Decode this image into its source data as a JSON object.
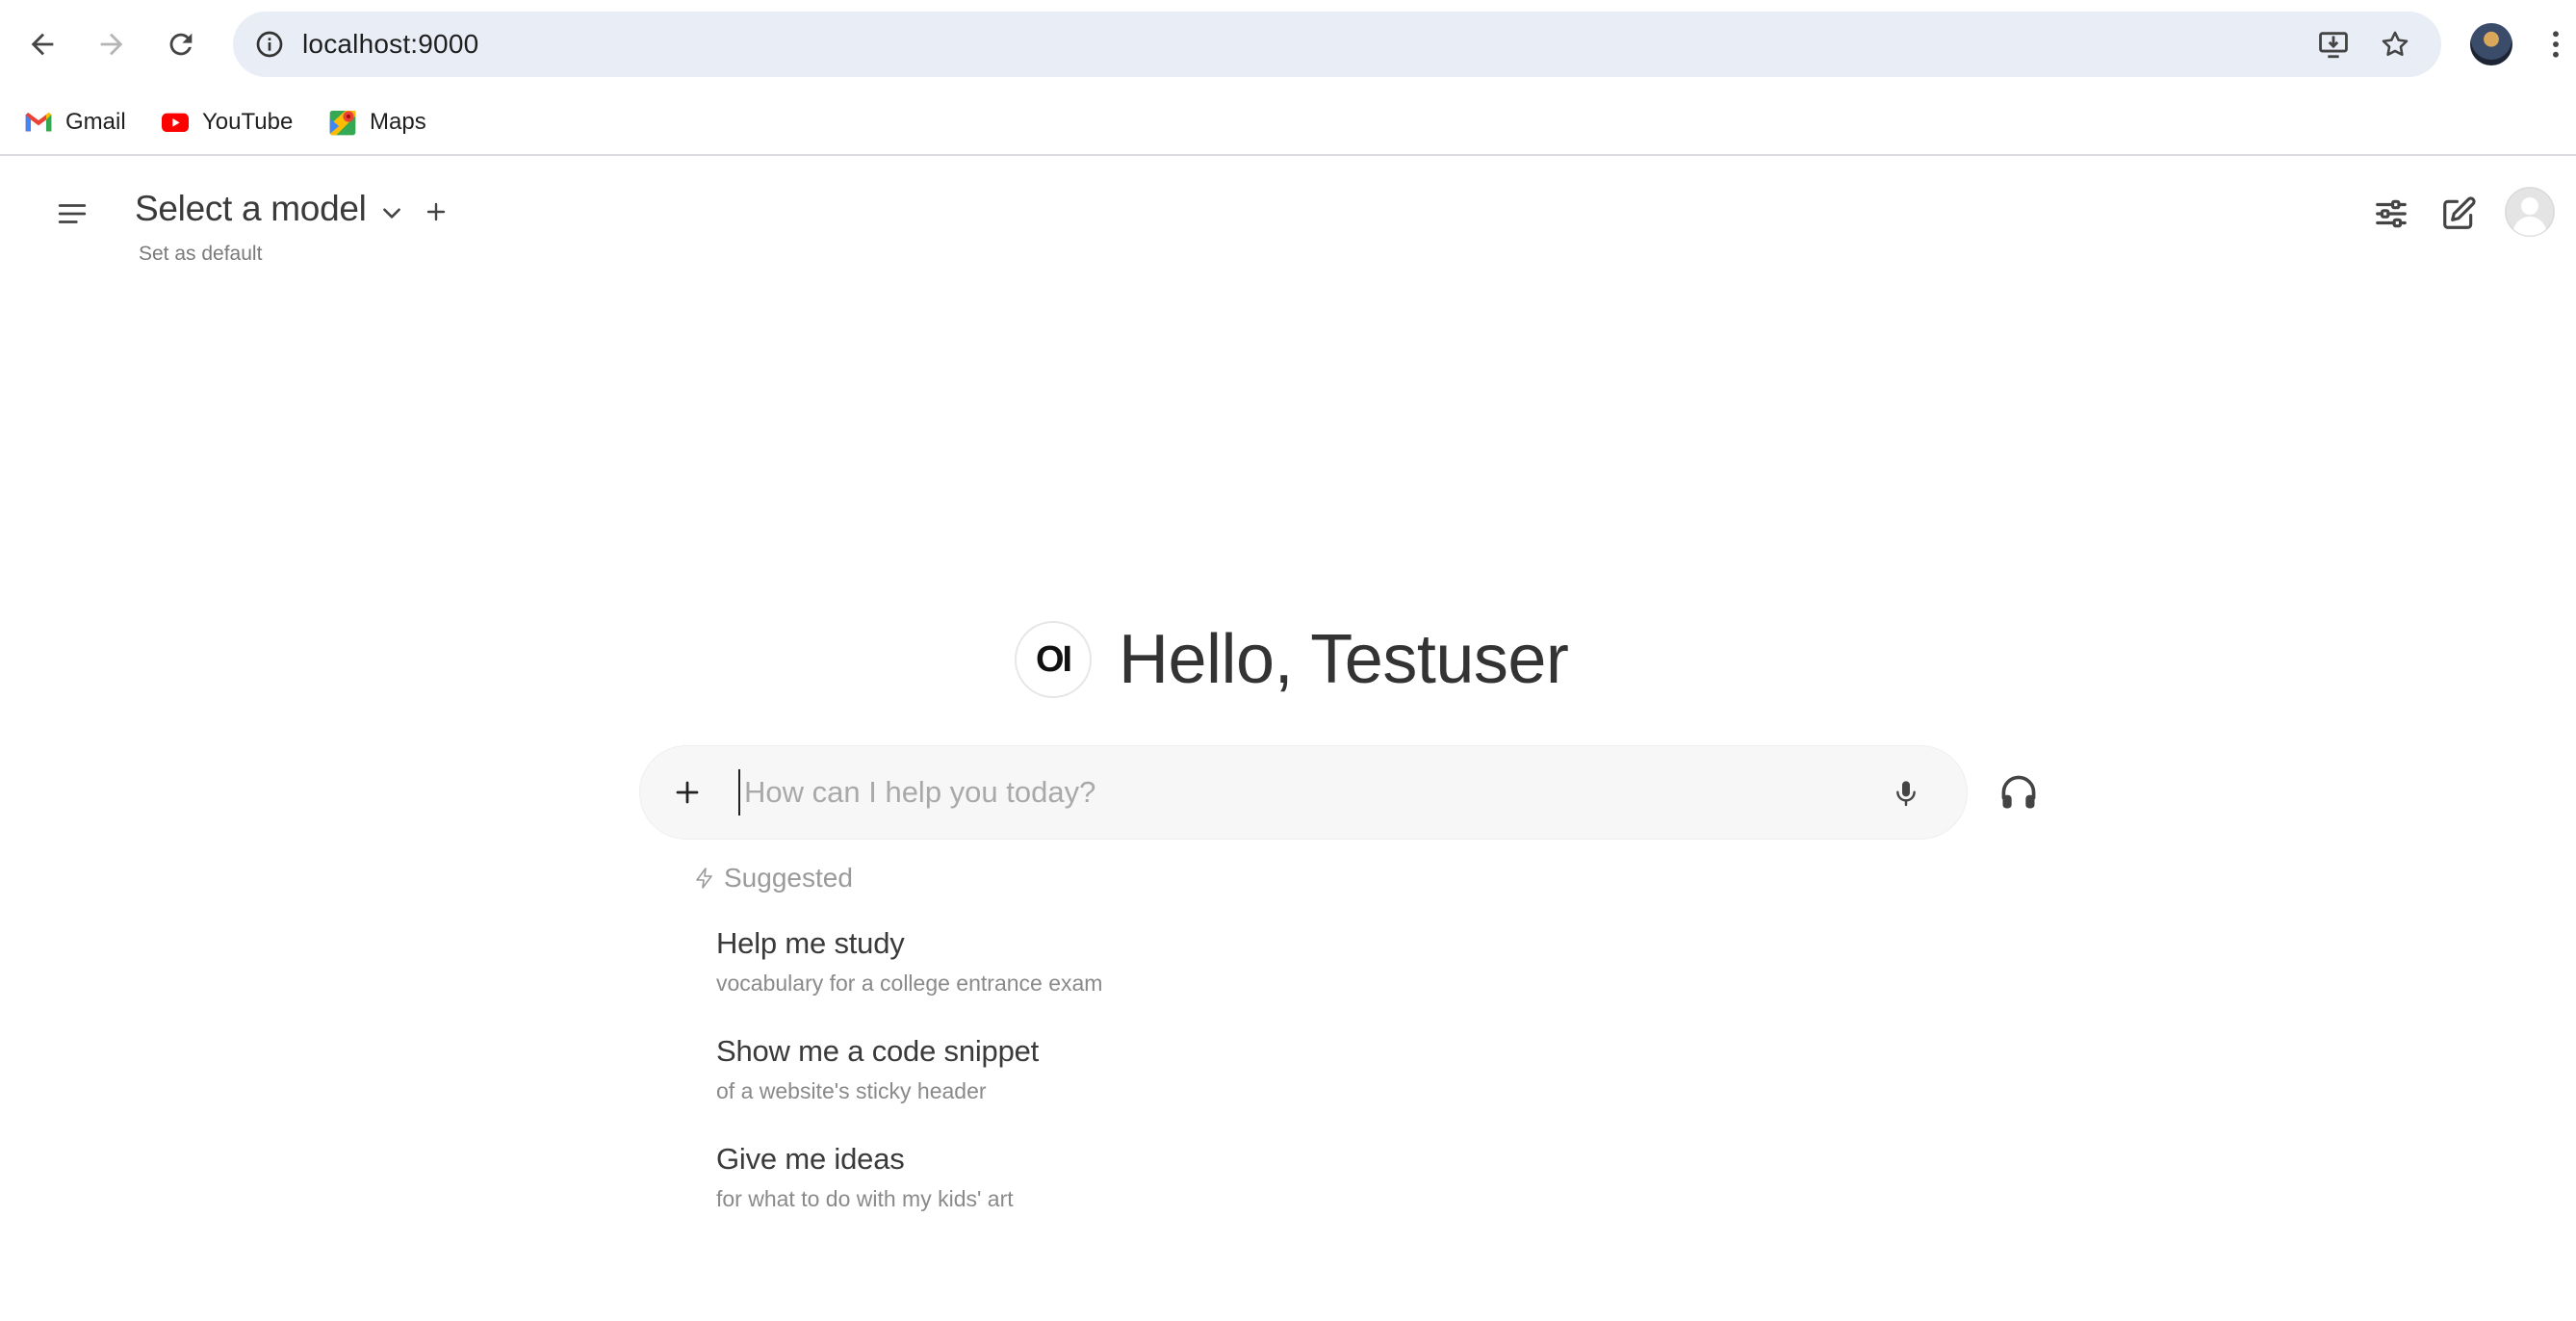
{
  "browser": {
    "url": "localhost:9000",
    "bookmarks": [
      {
        "label": "Gmail",
        "icon": "gmail-icon"
      },
      {
        "label": "YouTube",
        "icon": "youtube-icon"
      },
      {
        "label": "Maps",
        "icon": "maps-icon"
      }
    ]
  },
  "header": {
    "model_title": "Select a model",
    "set_default": "Set as default"
  },
  "main": {
    "greeting": "Hello, Testuser",
    "logo_text": "OI",
    "chat_placeholder": "How can I help you today?",
    "suggested_label": "Suggested",
    "suggestions": [
      {
        "title": "Help me study",
        "subtitle": "vocabulary for a college entrance exam"
      },
      {
        "title": "Show me a code snippet",
        "subtitle": "of a website's sticky header"
      },
      {
        "title": "Give me ideas",
        "subtitle": "for what to do with my kids' art"
      }
    ]
  },
  "colors": {
    "omnibox_bg": "#e9eef6",
    "chat_box_bg": "#f7f7f7",
    "text_primary": "#333333",
    "text_muted": "#8a8a8a"
  }
}
